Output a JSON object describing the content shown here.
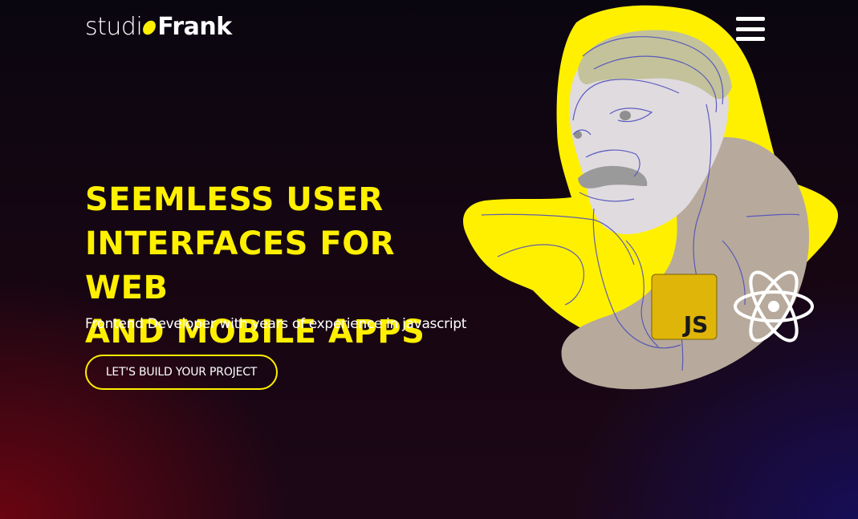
{
  "header": {
    "logo_part1": "studi",
    "logo_part2": "Frank",
    "menu_icon": "hamburger-menu-icon"
  },
  "hero": {
    "title_line1": "SEEMLESS USER",
    "title_line2": "INTERFACES FOR WEB",
    "title_line3": "AND MOBILE APPS",
    "subtitle": "Frontend Developer with years of experience in javascript",
    "cta_label": "LET'S BUILD YOUR PROJECT"
  },
  "illustration": {
    "js_badge_label": "JS",
    "icons": [
      "portrait-illustration",
      "javascript-logo-icon",
      "react-logo-icon"
    ]
  },
  "colors": {
    "accent_yellow": "#fff000",
    "text_white": "#ffffff",
    "blob_taupe": "#b7aa9c",
    "js_badge": "#e0b50a"
  }
}
